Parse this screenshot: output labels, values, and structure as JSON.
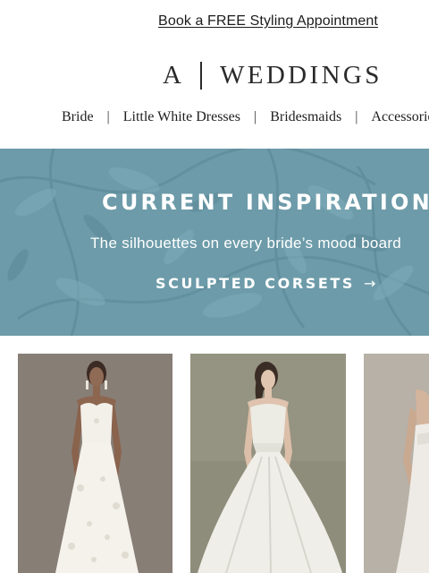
{
  "promo": {
    "link_text": "Book a FREE Styling Appointment"
  },
  "logo": {
    "mark": "A",
    "word": "WEDDINGS"
  },
  "nav": {
    "items": [
      "Bride",
      "Little White Dresses",
      "Bridesmaids",
      "Accessories"
    ],
    "separator": "|"
  },
  "banner": {
    "headline": "CURRENT INSPIRATION",
    "subheadline": "The silhouettes on every bride’s mood board",
    "cta_label": "SCULPTED CORSETS",
    "cta_arrow": "→",
    "background_color": "#6d9ba9"
  },
  "products": [
    {
      "image": "dress-photo-1",
      "alt": "model in white lace strapless dress"
    },
    {
      "image": "dress-photo-2",
      "alt": "model in strapless satin ball gown"
    },
    {
      "image": "dress-photo-3",
      "alt": "model in white column gown"
    }
  ]
}
